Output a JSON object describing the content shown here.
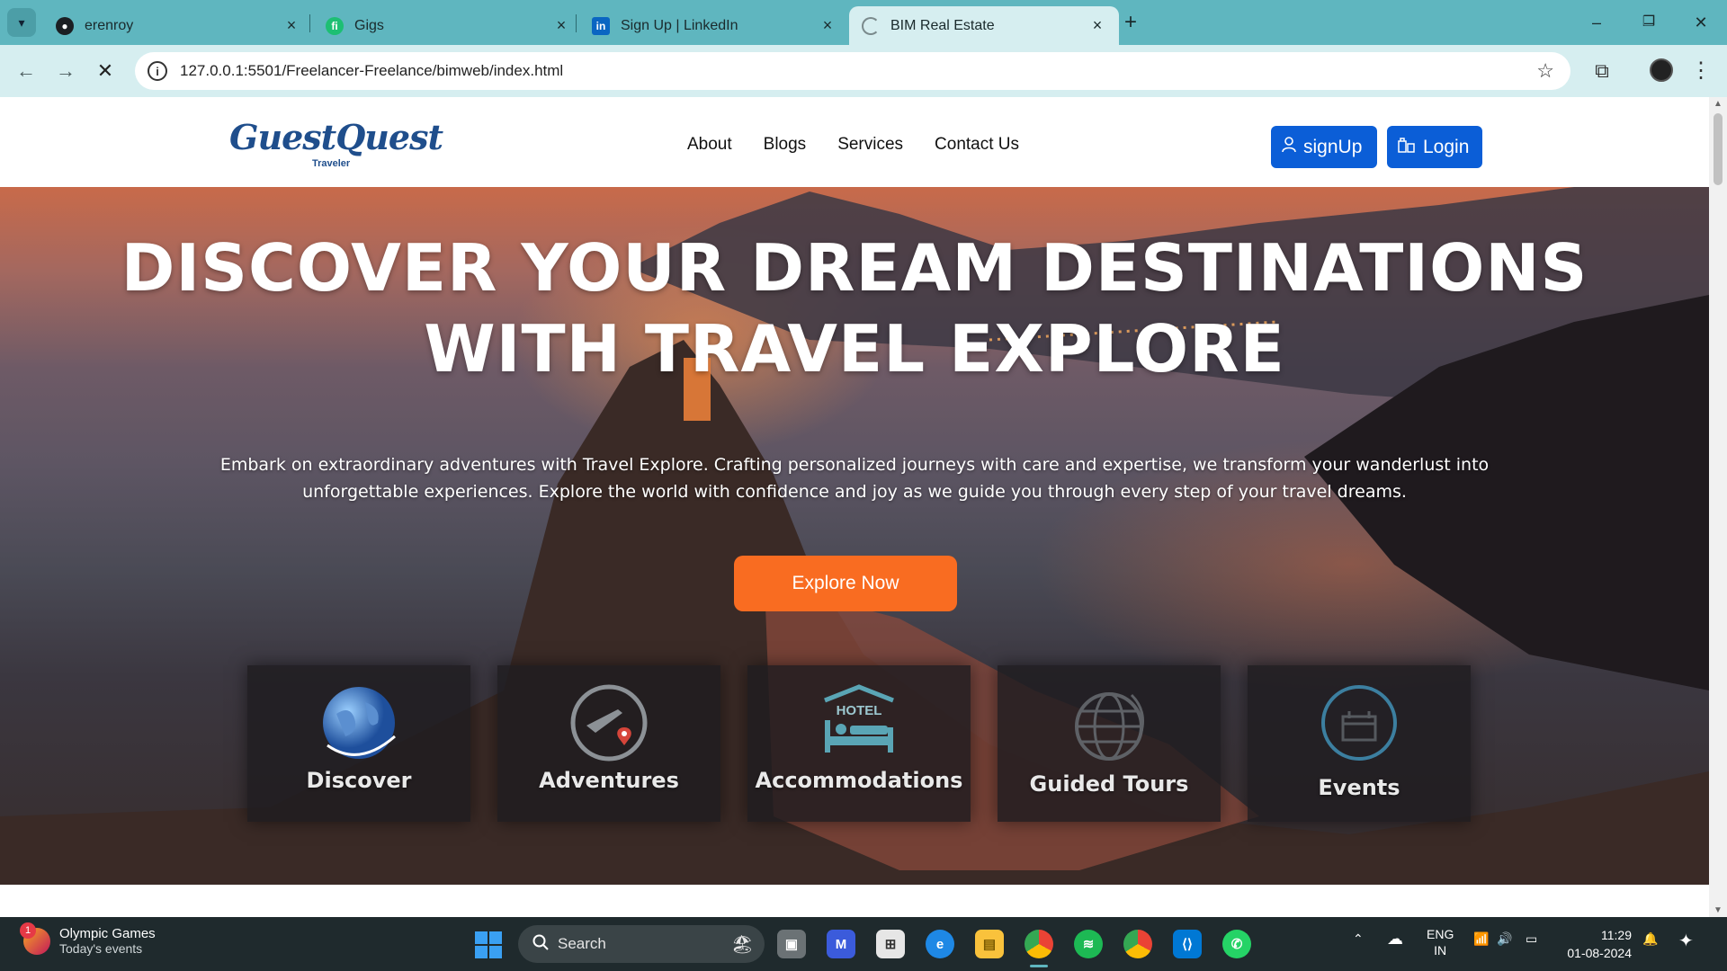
{
  "browser": {
    "tabs": [
      {
        "title": "erenroy",
        "icon": "github-icon"
      },
      {
        "title": "Gigs",
        "icon": "fiverr-icon"
      },
      {
        "title": "Sign Up | LinkedIn",
        "icon": "linkedin-icon"
      },
      {
        "title": "BIM Real Estate",
        "icon": "loading-icon",
        "active": true
      }
    ],
    "url": "127.0.0.1:5501/Freelancer-Freelance/bimweb/index.html"
  },
  "site": {
    "logo": {
      "main": "GuestQuest",
      "sub": "Traveler"
    },
    "menu": [
      "About",
      "Blogs",
      "Services",
      "Contact Us"
    ],
    "signup_label": "signUp",
    "login_label": "Login",
    "hero": {
      "title_line1": "DISCOVER YOUR DREAM DESTINATIONS",
      "title_line2": "WITH TRAVEL EXPLORE",
      "description": "Embark on extraordinary adventures with Travel Explore. Crafting personalized journeys with care and expertise, we transform your wanderlust into unforgettable experiences. Explore the world with confidence and joy as we guide you through every step of your travel dreams.",
      "cta_label": "Explore Now"
    },
    "cards": [
      {
        "label": "Discover",
        "icon": "globe-icon"
      },
      {
        "label": "Adventures",
        "icon": "plane-pin-icon"
      },
      {
        "label": "Accommodations",
        "icon": "hotel-icon",
        "icon_text": "HOTEL"
      },
      {
        "label": "Guided Tours",
        "icon": "globe-outline-icon"
      },
      {
        "label": "Events",
        "icon": "events-icon"
      }
    ],
    "colors": {
      "primary_button": "#0b5ed7",
      "cta": "#f96c21"
    }
  },
  "taskbar": {
    "widget": {
      "title": "Olympic Games",
      "subtitle": "Today's events",
      "badge": "1"
    },
    "search_placeholder": "Search",
    "language": {
      "line1": "ENG",
      "line2": "IN"
    },
    "time": "11:29",
    "date": "01-08-2024"
  }
}
